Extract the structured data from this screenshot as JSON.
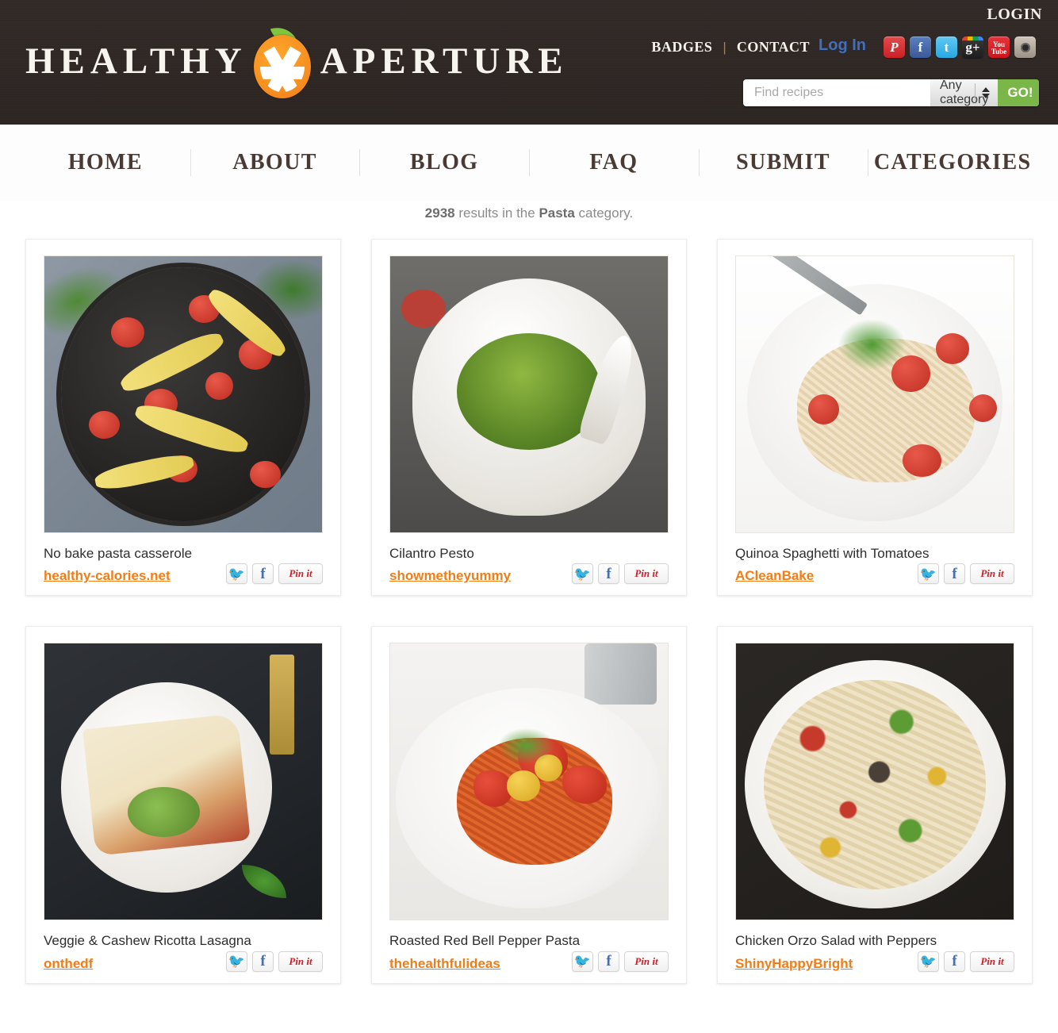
{
  "header": {
    "login_top": "LOGIN",
    "brand": {
      "word1": "HEALTHY",
      "word2": "APERTURE",
      "mark": "orange-aperture-logo"
    },
    "utility": {
      "badges": "BADGES",
      "separator": "|",
      "contact": "CONTACT",
      "log_in": "Log In"
    },
    "socials": [
      {
        "name": "pinterest-icon",
        "glyph": "P"
      },
      {
        "name": "facebook-icon",
        "glyph": "f"
      },
      {
        "name": "twitter-icon",
        "glyph": "t"
      },
      {
        "name": "google-plus-icon",
        "glyph": "g+"
      },
      {
        "name": "youtube-icon",
        "glyph": "You Tube"
      },
      {
        "name": "instagram-icon",
        "glyph": ""
      }
    ],
    "search": {
      "placeholder": "Find recipes",
      "value": "",
      "category_selected": "Any category",
      "go_label": "GO!"
    }
  },
  "nav": {
    "items": [
      {
        "label": "HOME"
      },
      {
        "label": "ABOUT"
      },
      {
        "label": "BLOG"
      },
      {
        "label": "FAQ"
      },
      {
        "label": "SUBMIT"
      },
      {
        "label": "CATEGORIES"
      }
    ]
  },
  "results": {
    "count": "2938",
    "mid_text": " results in the ",
    "category": "Pasta",
    "suffix": " category."
  },
  "share": {
    "twitter_label": "t",
    "facebook_label": "f",
    "pinterest_label": "Pin it"
  },
  "cards": [
    {
      "title": "No bake pasta casserole",
      "source": "healthy-calories.net",
      "image": "skillet-pasta-with-tomatoes-photo"
    },
    {
      "title": "Cilantro Pesto",
      "source": "showmetheyummy",
      "image": "green-pesto-in-white-bowl-photo"
    },
    {
      "title": "Quinoa Spaghetti with Tomatoes",
      "source": "ACleanBake",
      "image": "spaghetti-with-tomatoes-white-bowl-photo"
    },
    {
      "title": "Veggie & Cashew Ricotta Lasagna",
      "source": "onthedf",
      "image": "lasagna-slice-on-white-plate-photo"
    },
    {
      "title": "Roasted Red Bell Pepper Pasta",
      "source": "thehealthfulideas",
      "image": "red-pepper-pasta-white-plate-photo"
    },
    {
      "title": "Chicken Orzo Salad with Peppers",
      "source": "ShinyHappyBright",
      "image": "chicken-orzo-salad-white-bowl-photo"
    }
  ],
  "colors": {
    "header_bg": "#2e2724",
    "accent_orange": "#f07d16",
    "go_green": "#7ab648",
    "login_blue": "#3f6fbd",
    "nav_text": "#4a3a33"
  }
}
